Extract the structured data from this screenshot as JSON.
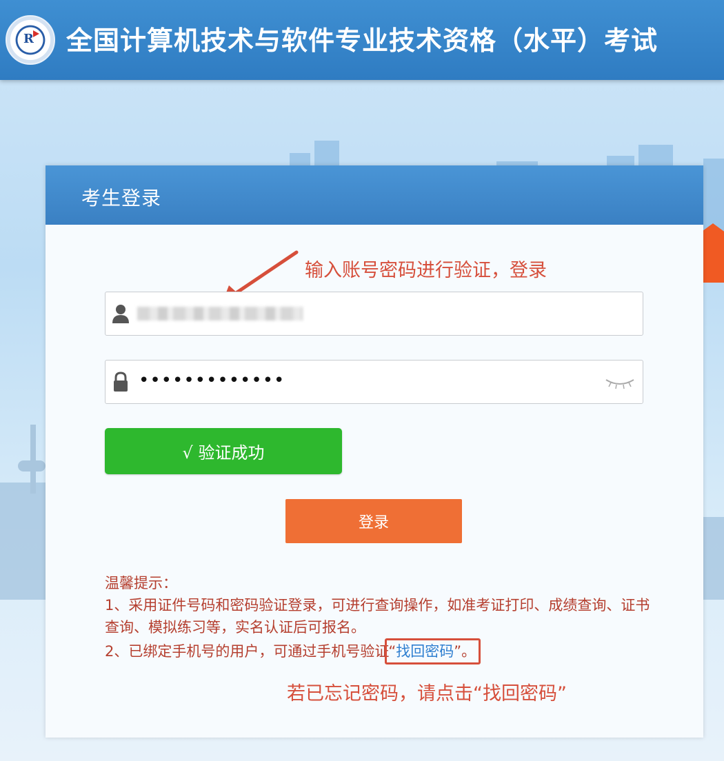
{
  "header": {
    "title": "全国计算机技术与软件专业技术资格（水平）考试"
  },
  "login_panel": {
    "title": "考生登录",
    "annotation_top": "输入账号密码进行验证，登录",
    "username_field": {
      "value": ""
    },
    "password_field": {
      "value": "•••••••••••••"
    },
    "verify_button_label": "√ 验证成功",
    "login_button_label": "登录",
    "tips": {
      "heading": "温馨提示：",
      "line1": "1、采用证件号码和密码验证登录，可进行查询操作，如准考证打印、成绩查询、证书查询、模拟练习等，实名认证后可报名。",
      "line2_prefix": "2、已绑定手机号的用户，可通过手机号验证",
      "line2_link_open": "“",
      "line2_link": "找回密码",
      "line2_link_close": "”。"
    },
    "annotation_bottom": "若已忘记密码，请点击“找回密码”"
  },
  "colors": {
    "header_blue": "#2f7cc2",
    "verify_green": "#2eb82e",
    "login_orange": "#ef6f35",
    "annotation_red": "#d64f3b",
    "link_blue": "#2f7fd0"
  },
  "icons": [
    "logo-emblem",
    "user-icon",
    "lock-icon",
    "eye-closed-icon",
    "arrow-annotation"
  ]
}
